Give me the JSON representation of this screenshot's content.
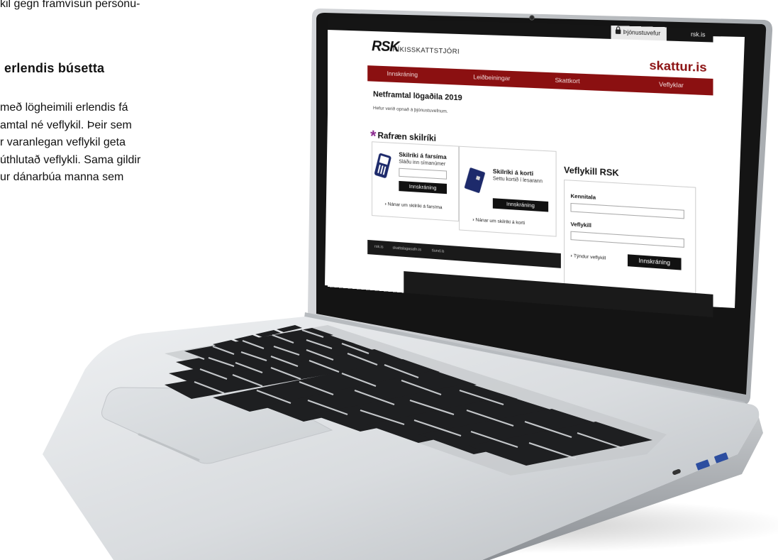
{
  "article": {
    "intro_line": "kil gegn framvísun persónu-",
    "heading": "erlendis búsetta",
    "body_lines": [
      "með lögheimili erlendis fá",
      "amtal né veflykil. Þeir sem",
      "r varanlegan veflykil geta",
      "úthlutað veflykli. Sama gildir",
      "ur dánarbúa manna sem"
    ]
  },
  "site": {
    "service_tab": "Þjónustuvefur",
    "rsk_tab": "rsk.is",
    "logo": "RSK",
    "logo_sub": "RÍKISSKATTSTJÓRI",
    "brand": "skattur.is",
    "nav": [
      "Innskráning",
      "Leiðbeiningar",
      "Skattkort",
      "Veflyklar"
    ],
    "content_title": "Netframtal lögaðila 2019",
    "content_sub": "Hefur verið opnað á þjónustuvefnum.",
    "eid_heading": "Rafræn skilríki",
    "phone": {
      "title": "Skilríki á farsíma",
      "subtitle": "Sláðu inn símanúmer",
      "button": "Innskráning",
      "more": "Nánar um skilríki á farsíma"
    },
    "card": {
      "title": "Skilríki á korti",
      "subtitle": "Settu kortið í lesarann",
      "button": "Innskráning",
      "more": "Nánar um skilríki á korti"
    },
    "veflykill": {
      "title": "Veflykill RSK",
      "kennitala_label": "Kennitala",
      "veflykill_label": "Veflykill",
      "lost": "Týndur veflykill",
      "button": "Innskráning"
    },
    "footer": [
      "rsk.is",
      "skattalagasafn.is",
      "tiund.is"
    ]
  },
  "colors": {
    "brand_red": "#8b1011",
    "accent_purple": "#8a2a8f",
    "icon_blue": "#1d2a6b"
  }
}
